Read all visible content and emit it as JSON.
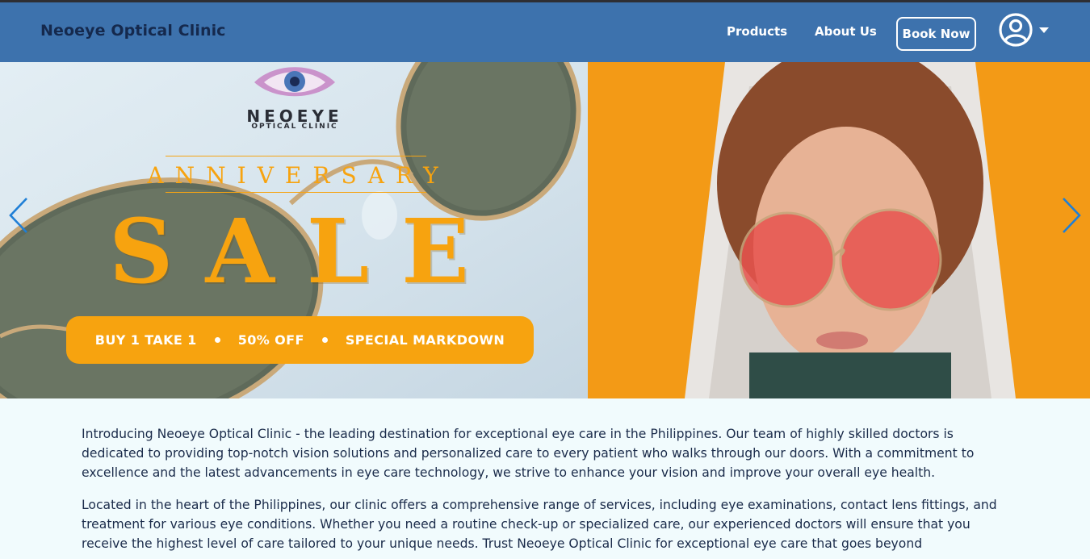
{
  "navbar": {
    "brand": "Neoeye Optical Clinic",
    "links": [
      {
        "label": "Products"
      },
      {
        "label": "About Us"
      }
    ],
    "book_label": "Book Now",
    "user_icon": "user-circle-icon",
    "dropdown_icon": "caret-down-icon"
  },
  "hero": {
    "logo_name": "NEOEYE",
    "logo_sub": "OPTICAL CLINIC",
    "headline_small": "ANNIVERSARY",
    "headline_big": "SALE",
    "promos": [
      "BUY 1 TAKE 1",
      "50% OFF",
      "SPECIAL MARKDOWN"
    ],
    "prev_icon": "chevron-left-icon",
    "next_icon": "chevron-right-icon",
    "accent_color": "#f7a30f"
  },
  "content": {
    "paragraphs": [
      "Introducing Neoeye Optical Clinic - the leading destination for exceptional eye care in the Philippines. Our team of highly skilled doctors is dedicated to providing top-notch vision solutions and personalized care to every patient who walks through our doors. With a commitment to excellence and the latest advancements in eye care technology, we strive to enhance your vision and improve your overall eye health.",
      "Located in the heart of the Philippines, our clinic offers a comprehensive range of services, including eye examinations, contact lens fittings, and treatment for various eye conditions. Whether you need a routine check-up or specialized care, our experienced doctors will ensure that you receive the highest level of care tailored to your unique needs. Trust Neoeye Optical Clinic for exceptional eye care that goes beyond"
    ]
  },
  "colors": {
    "navbar": "#3d72ad",
    "brand_text": "#15294d",
    "page_bg": "#f1fbfd",
    "hero_right_bg": "#f39a16"
  }
}
